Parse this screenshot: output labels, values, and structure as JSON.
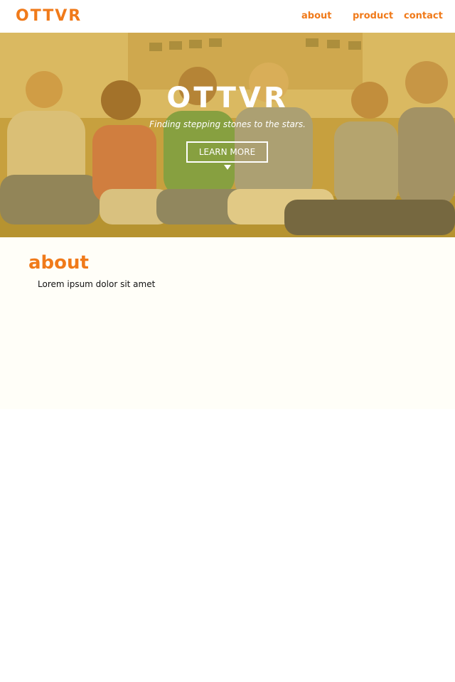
{
  "colors": {
    "accent": "#f07a1a",
    "hero_tint": "#dcaa28",
    "section_bg": "#fffef8"
  },
  "nav": {
    "brand": "OTTVR",
    "links": [
      "about",
      "product",
      "contact"
    ]
  },
  "hero": {
    "title": "OTTVR",
    "tagline": "Finding stepping stones to the stars.",
    "button_label": "LEARN MORE",
    "arrow_icon": "triangle-down-icon"
  },
  "about": {
    "heading": "about",
    "body": "Lorem ipsum dolor sit amet"
  }
}
